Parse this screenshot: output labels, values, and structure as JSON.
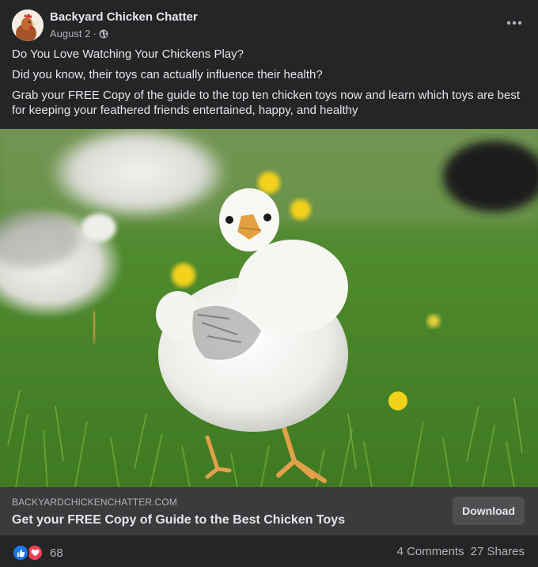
{
  "post": {
    "page_name": "Backyard Chicken Chatter",
    "date": "August 2",
    "separator": "·",
    "paragraphs": [
      "Do You Love Watching Your Chickens Play?",
      "Did you know, their toys can actually influence their health?",
      "Grab your FREE Copy of the guide to the top ten chicken toys now and learn which toys are best for keeping your feathered friends entertained, happy, and healthy"
    ]
  },
  "link": {
    "domain": "BACKYARDCHICKENCHATTER.COM",
    "title": "Get your FREE Copy of Guide to the Best Chicken Toys",
    "button_label": "Download"
  },
  "stats": {
    "reaction_count": "68",
    "comments": "4 Comments",
    "shares": "27 Shares"
  },
  "icons": {
    "more": "more-horizontal-icon",
    "privacy": "globe-icon",
    "like": "like-reaction-icon",
    "love": "love-reaction-icon"
  },
  "colors": {
    "background": "#242526",
    "link_bar": "#3a3b3c",
    "like_blue": "#1877f2",
    "love_red": "#f33e58",
    "secondary_text": "#b0b3b8",
    "primary_text": "#e4e6eb"
  }
}
